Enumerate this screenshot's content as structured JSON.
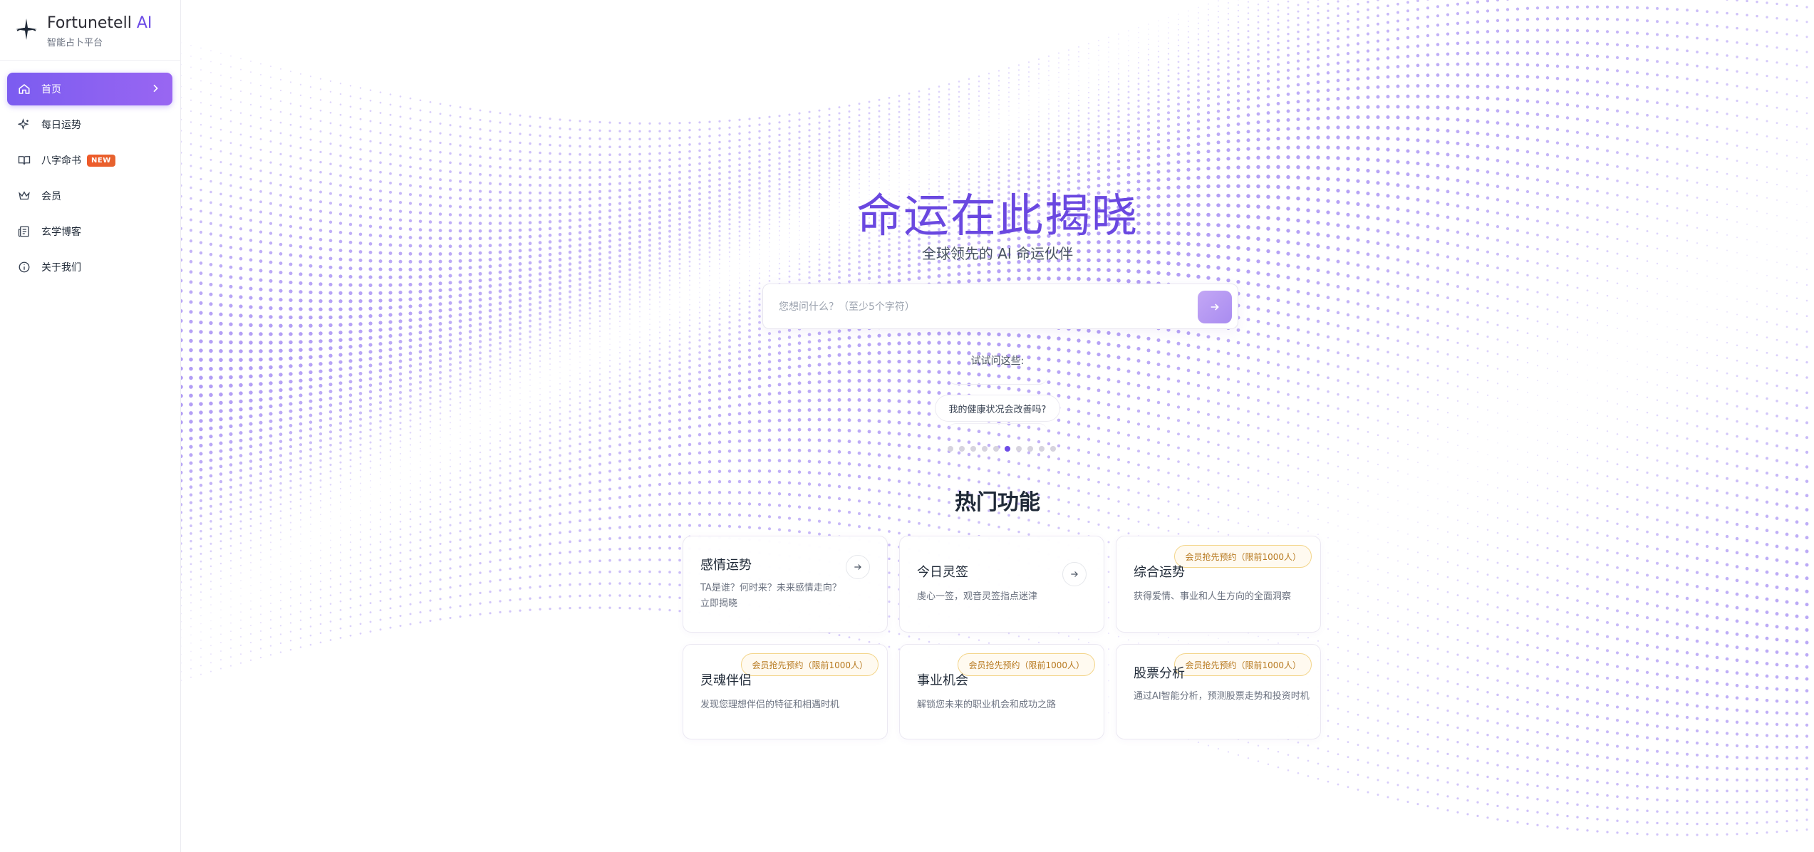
{
  "brand": {
    "name": "Fortunetell",
    "name_ai": "AI",
    "subtitle": "智能占卜平台"
  },
  "nav": {
    "items": [
      {
        "label": "首页",
        "icon": "home-icon",
        "active": true
      },
      {
        "label": "每日运势",
        "icon": "sparkles-icon"
      },
      {
        "label": "八字命书",
        "icon": "book-icon",
        "badge": "NEW"
      },
      {
        "label": "会员",
        "icon": "crown-icon"
      },
      {
        "label": "玄学博客",
        "icon": "newspaper-icon"
      },
      {
        "label": "关于我们",
        "icon": "info-icon"
      }
    ]
  },
  "hero": {
    "title": "命运在此揭晓",
    "subtitle": "全球领先的 AI 命运伙伴"
  },
  "search": {
    "placeholder": "您想问什么？（至少5个字符）",
    "value": "",
    "submit_icon": "arrow-right-icon"
  },
  "suggestions": {
    "label": "试试问这些:",
    "current": "我的健康状况会改善吗?",
    "dot_count": 10,
    "active_index": 5
  },
  "features": {
    "title": "热门功能",
    "cards": [
      {
        "title": "感情运势",
        "desc": "TA是谁？何时来？未来感情走向？立即揭晓",
        "badge": "",
        "arrow": "arrow-right-icon"
      },
      {
        "title": "今日灵签",
        "desc": "虔心一签，观音灵签指点迷津",
        "badge": "",
        "arrow": "arrow-right-icon"
      },
      {
        "title": "综合运势",
        "desc": "获得爱情、事业和人生方向的全面洞察",
        "badge": "会员抢先预约（限前1000人）"
      },
      {
        "title": "灵魂伴侣",
        "desc": "发现您理想伴侣的特征和相遇时机",
        "badge": "会员抢先预约（限前1000人）"
      },
      {
        "title": "事业机会",
        "desc": "解锁您未来的职业机会和成功之路",
        "badge": "会员抢先预约（限前1000人）"
      },
      {
        "title": "股票分析",
        "desc": "通过AI智能分析，预测股票走势和投资时机",
        "badge": "会员抢先预约（限前1000人）"
      }
    ]
  },
  "colors": {
    "accent": "#6d4ce6",
    "accent_light": "#9966f2",
    "badge_new": "#ef5a2a",
    "gold": "#b7791f"
  }
}
